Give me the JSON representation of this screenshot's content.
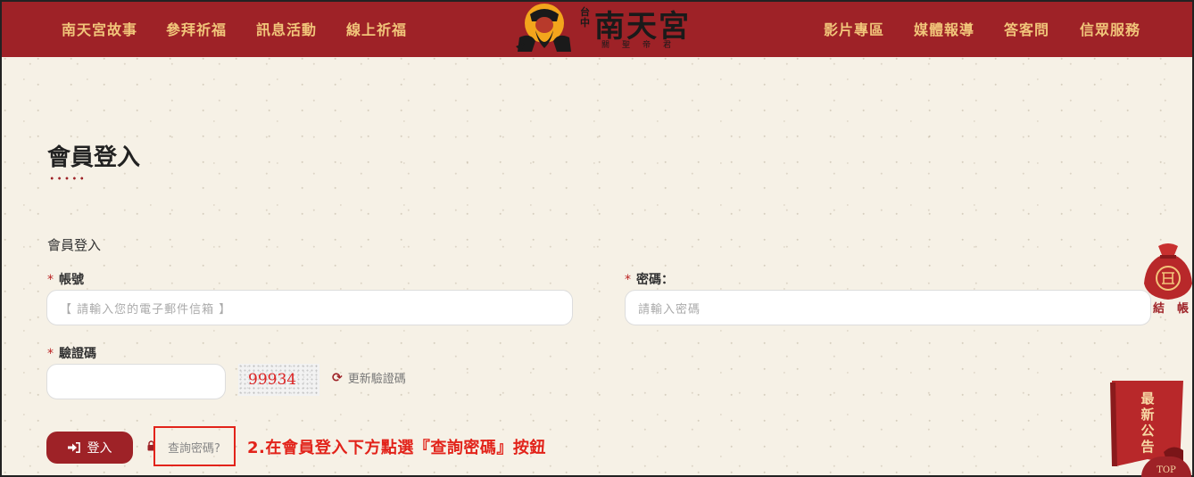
{
  "nav": {
    "left": [
      "南天宮故事",
      "參拜祈福",
      "訊息活動",
      "線上祈福"
    ],
    "right": [
      "影片專區",
      "媒體報導",
      "答客問",
      "信眾服務"
    ]
  },
  "logo": {
    "small": "台中",
    "title": "南天宮",
    "sub": "關聖帝君"
  },
  "page": {
    "title": "會員登入",
    "section": "會員登入"
  },
  "form": {
    "account_label": "帳號",
    "account_placeholder": "【 請輸入您的電子郵件信箱 】",
    "password_label": "密碼：",
    "password_placeholder": "請輸入密碼",
    "captcha_label": "驗證碼",
    "captcha_value": "",
    "captcha_image_text": "99934",
    "refresh_label": "更新驗證碼",
    "required_mark": "*",
    "login_label": "登入",
    "query_password_label": "查詢密碼?"
  },
  "annotation": "2.在會員登入下方點選『查詢密碼』按鈕",
  "widgets": {
    "checkout_label": "結帳",
    "news_label": "最新公告",
    "top_label": "TOP"
  },
  "colors": {
    "brand_red": "#9e2227",
    "nav_gold": "#f1c57a",
    "annotation_red": "#e2231a",
    "background": "#f6f1e6"
  }
}
